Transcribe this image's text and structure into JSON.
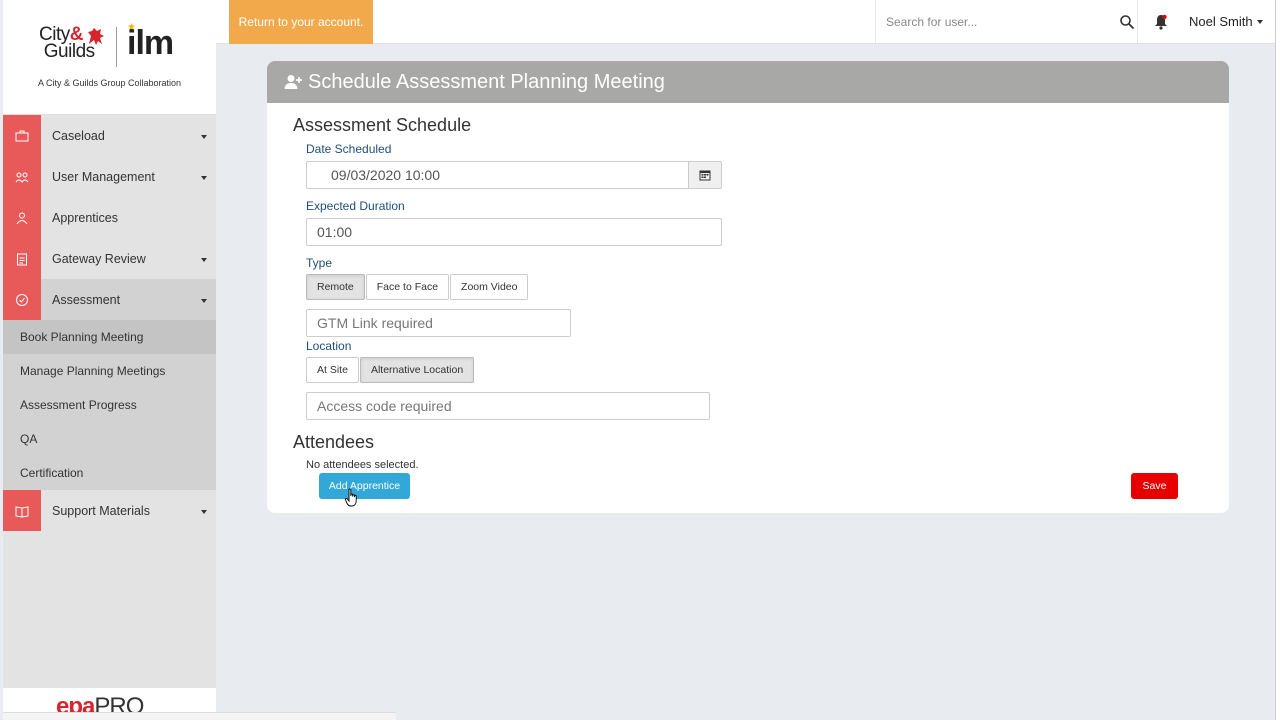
{
  "brand": {
    "cg_line1": "City",
    "cg_amp": "&",
    "cg_line2": "Guilds",
    "ilm": "ilm",
    "tagline": "A City & Guilds Group Collaboration",
    "footer_logo_a": "epa",
    "footer_logo_b": "PRO"
  },
  "sidebar": {
    "items": [
      {
        "label": "Caseload",
        "icon": "briefcase-icon"
      },
      {
        "label": "User Management",
        "icon": "users-icon"
      },
      {
        "label": "Apprentices",
        "icon": "user-icon"
      },
      {
        "label": "Gateway Review",
        "icon": "clipboard-icon"
      },
      {
        "label": "Assessment",
        "icon": "check-circle-icon"
      },
      {
        "label": "Support Materials",
        "icon": "book-icon"
      }
    ],
    "assessment_sub": [
      "Book Planning Meeting",
      "Manage Planning Meetings",
      "Assessment Progress",
      "QA",
      "Certification"
    ]
  },
  "topbar": {
    "return_label": "Return to your account.",
    "search_placeholder": "Search for user...",
    "user_name": "Noel Smith"
  },
  "panel": {
    "title": "Schedule Assessment Planning Meeting",
    "schedule_title": "Assessment Schedule",
    "date_label": "Date Scheduled",
    "date_value": "09/03/2020 10:00",
    "duration_label": "Expected Duration",
    "duration_value": "01:00",
    "type_label": "Type",
    "type_options": [
      "Remote",
      "Face to Face",
      "Zoom Video"
    ],
    "type_selected": "Remote",
    "gtm_placeholder": "GTM Link required",
    "location_label": "Location",
    "location_options": [
      "At Site",
      "Alternative Location"
    ],
    "location_selected": "Alternative Location",
    "access_placeholder": "Access code required",
    "attendees_title": "Attendees",
    "no_attendees": "No attendees selected.",
    "add_label": "Add Apprentice",
    "save_label": "Save"
  },
  "colors": {
    "sidebar_icon_bg": "#e85a5a",
    "return_btn": "#f1a94c",
    "panel_header": "#a8a8a6",
    "add_btn": "#32a8d8",
    "save_btn": "#e60000",
    "label_blue": "#1f4e79"
  }
}
